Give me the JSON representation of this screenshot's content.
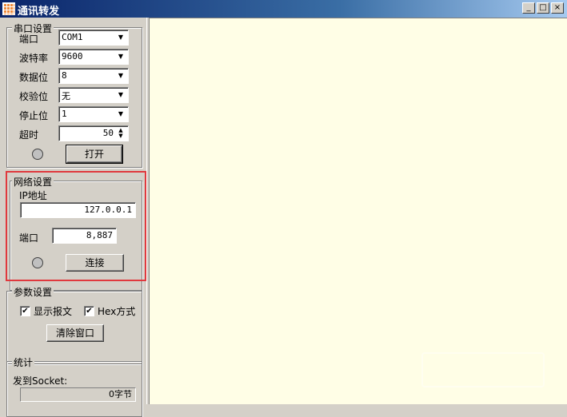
{
  "window": {
    "title": "通讯转发",
    "icon": "grid-app-icon",
    "controls": [
      "_",
      "□",
      "×"
    ]
  },
  "serial": {
    "title": "串口设置",
    "port_label": "端口",
    "port_value": "COM1",
    "baud_label": "波特率",
    "baud_value": "9600",
    "databits_label": "数据位",
    "databits_value": "8",
    "parity_label": "校验位",
    "parity_value": "无",
    "stopbits_label": "停止位",
    "stopbits_value": "1",
    "timeout_label": "超时",
    "timeout_value": "50",
    "open_button": "打开"
  },
  "network": {
    "title": "网络设置",
    "ip_label": "IP地址",
    "ip_value": "127.0.0.1",
    "port_label": "端口",
    "port_value": "8,887",
    "connect_button": "连接"
  },
  "params": {
    "title": "参数设置",
    "show_message_label": "显示报文",
    "show_message_checked": true,
    "hex_mode_label": "Hex方式",
    "hex_mode_checked": true,
    "clear_button": "清除窗口"
  },
  "stats": {
    "title": "统计",
    "sent_socket_label": "发到Socket:",
    "sent_socket_value": "0字节"
  },
  "colors": {
    "highlight": "#e0393e",
    "log_background": "#fffee6"
  }
}
